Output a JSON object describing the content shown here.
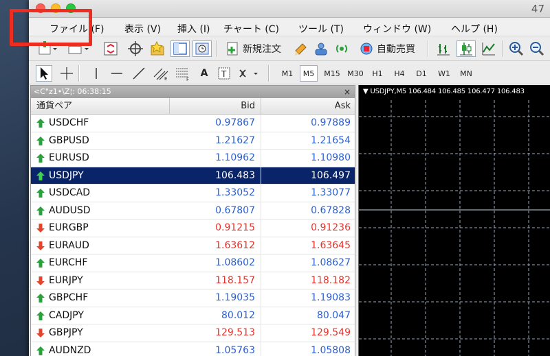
{
  "window": {
    "title": "47"
  },
  "menu": [
    {
      "label": "ファイル (F)"
    },
    {
      "label": "表示 (V)"
    },
    {
      "label": "挿入 (I)"
    },
    {
      "label": "チャート (C)"
    },
    {
      "label": "ツール (T)"
    },
    {
      "label": "ウィンドウ (W)"
    },
    {
      "label": "ヘルプ (H)"
    }
  ],
  "toolbar": {
    "new_order_label": "新規注文",
    "auto_trading_label": "自動売買",
    "text_tool_label": "A",
    "timeframes": [
      "M1",
      "M5",
      "M15",
      "M30",
      "H1",
      "H4",
      "D1",
      "W1",
      "MN"
    ],
    "active_timeframe": "M5"
  },
  "market_watch": {
    "title": "<C\"z1•\\Z¦: 06:38:15",
    "close_label": "×",
    "headers": {
      "symbol": "通貨ペア",
      "bid": "Bid",
      "ask": "Ask"
    },
    "colors": {
      "up": "#2b5fd1",
      "down": "#e8302a",
      "up_arrow": "#2aa13a",
      "down_arrow": "#e2452b",
      "selected_bg": "#0a246a"
    },
    "rows": [
      {
        "symbol": "USDCHF",
        "bid": "0.97867",
        "ask": "0.97889",
        "dir": "up"
      },
      {
        "symbol": "GBPUSD",
        "bid": "1.21627",
        "ask": "1.21654",
        "dir": "up"
      },
      {
        "symbol": "EURUSD",
        "bid": "1.10962",
        "ask": "1.10980",
        "dir": "up"
      },
      {
        "symbol": "USDJPY",
        "bid": "106.483",
        "ask": "106.497",
        "dir": "up",
        "selected": true
      },
      {
        "symbol": "USDCAD",
        "bid": "1.33052",
        "ask": "1.33077",
        "dir": "up"
      },
      {
        "symbol": "AUDUSD",
        "bid": "0.67807",
        "ask": "0.67828",
        "dir": "up"
      },
      {
        "symbol": "EURGBP",
        "bid": "0.91215",
        "ask": "0.91236",
        "dir": "down"
      },
      {
        "symbol": "EURAUD",
        "bid": "1.63612",
        "ask": "1.63645",
        "dir": "down"
      },
      {
        "symbol": "EURCHF",
        "bid": "1.08602",
        "ask": "1.08627",
        "dir": "up"
      },
      {
        "symbol": "EURJPY",
        "bid": "118.157",
        "ask": "118.182",
        "dir": "down"
      },
      {
        "symbol": "GBPCHF",
        "bid": "1.19035",
        "ask": "1.19083",
        "dir": "up"
      },
      {
        "symbol": "CADJPY",
        "bid": "80.012",
        "ask": "80.047",
        "dir": "up"
      },
      {
        "symbol": "GBPJPY",
        "bid": "129.513",
        "ask": "129.549",
        "dir": "down"
      },
      {
        "symbol": "AUDNZD",
        "bid": "1.05763",
        "ask": "1.05808",
        "dir": "up"
      }
    ]
  },
  "chart": {
    "label": "▼ USDJPY,M5  106.484 106.485 106.477 106.483",
    "background": "#000000",
    "grid_color": "#9aa7b8"
  }
}
